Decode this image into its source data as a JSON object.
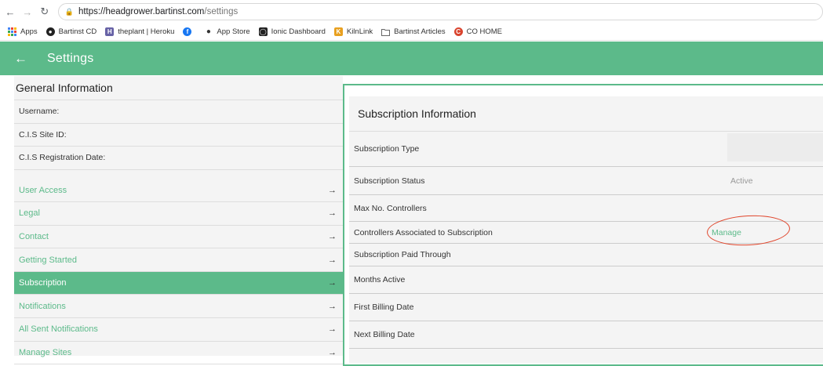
{
  "browser": {
    "url_host": "https://headgrower.bartinst.com",
    "url_path": "/settings",
    "bookmarks": [
      {
        "label": "Apps",
        "icon": "apps-grid-icon",
        "color": "#4285f4"
      },
      {
        "label": "Bartinst CD",
        "icon": "bartinst-logo-icon",
        "color": "#222222"
      },
      {
        "label": "theplant | Heroku",
        "icon": "heroku-icon",
        "color": "#6762a6"
      },
      {
        "label": "",
        "icon": "facebook-icon",
        "color": "#1877f2"
      },
      {
        "label": "App Store",
        "icon": "apple-icon",
        "color": "#333333"
      },
      {
        "label": "Ionic Dashboard",
        "icon": "ionic-icon",
        "color": "#222222"
      },
      {
        "label": "KilnLink",
        "icon": "kilnlink-icon",
        "color": "#e8a020"
      },
      {
        "label": "Bartinst Articles",
        "icon": "folder-icon",
        "color": "#777777"
      },
      {
        "label": "CO HOME",
        "icon": "co-home-icon",
        "color": "#d9442e"
      }
    ]
  },
  "header": {
    "title": "Settings"
  },
  "general": {
    "title": "General Information",
    "fields": [
      "Username:",
      "C.I.S Site ID:",
      "C.I.S Registration Date:"
    ]
  },
  "nav": {
    "items": [
      "User Access",
      "Legal",
      "Contact",
      "Getting Started",
      "Subscription",
      "Notifications",
      "All Sent Notifications",
      "Manage Sites"
    ],
    "active": "Subscription"
  },
  "subscription": {
    "title": "Subscription Information",
    "type_label": "Subscription Type",
    "status_label": "Subscription Status",
    "status_value": "Active",
    "max_label": "Max No. Controllers",
    "controllers_label": "Controllers Associated to Subscription",
    "manage_label": "Manage",
    "paid_label": "Subscription Paid Through",
    "months_label": "Months Active",
    "first_billing_label": "First Billing Date",
    "next_billing_label": "Next Billing Date"
  },
  "colors": {
    "accent": "#5cba8a",
    "highlight_circle": "#e0442a"
  }
}
